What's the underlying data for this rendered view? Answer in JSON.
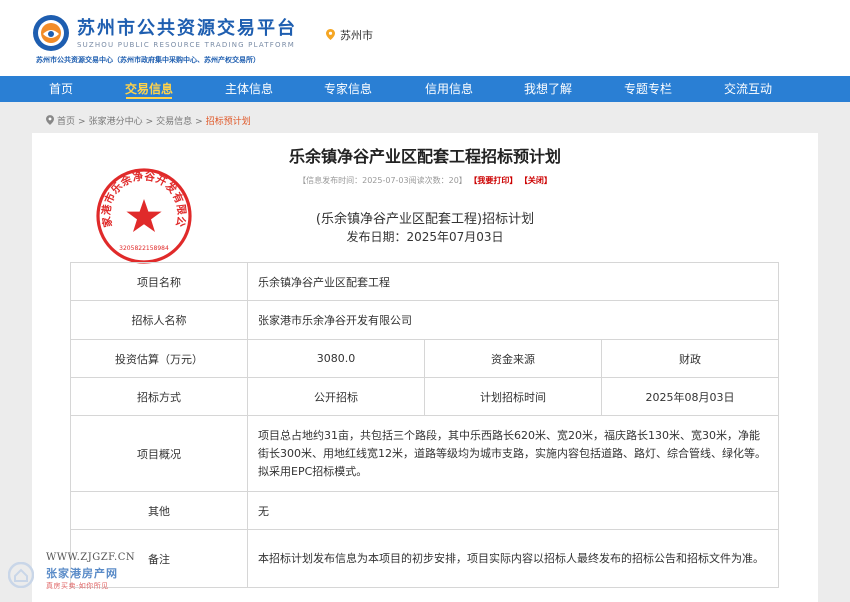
{
  "header": {
    "title": "苏州市公共资源交易平台",
    "title_en": "SUZHOU PUBLIC RESOURCE TRADING PLATFORM",
    "subtitle": "苏州市公共资源交易中心（苏州市政府集中采购中心、苏州产权交易所）",
    "location": "苏州市",
    "brand_color": "#1e5eb0"
  },
  "nav": {
    "color": "#2a7fd4",
    "active_color": "#ffd24a",
    "items": [
      {
        "label": "首页"
      },
      {
        "label": "交易信息"
      },
      {
        "label": "主体信息"
      },
      {
        "label": "专家信息"
      },
      {
        "label": "信用信息"
      },
      {
        "label": "我想了解"
      },
      {
        "label": "专题专栏"
      },
      {
        "label": "交流互动"
      }
    ]
  },
  "breadcrumb": {
    "items": [
      "首页",
      "张家港分中心",
      "交易信息"
    ],
    "separator": ">",
    "current": "招标预计划"
  },
  "article": {
    "title": "乐余镇净谷产业区配套工程招标预计划",
    "meta_text": "【信息发布时间：2025-07-03阅读次数：20】",
    "print_label": "【我要打印】",
    "close_label": "【关闭】",
    "plan_title": "(乐余镇净谷产业区配套工程)招标计划",
    "plan_date": "发布日期：2025年07月03日",
    "seal_text": "张家港市乐余净谷开发有限公司",
    "seal_number": "3205822158984"
  },
  "table": {
    "project_name_label": "项目名称",
    "project_name": "乐余镇净谷产业区配套工程",
    "tenderer_label": "招标人名称",
    "tenderer": "张家港市乐余净谷开发有限公司",
    "investment_label": "投资估算（万元）",
    "investment": "3080.0",
    "fund_source_label": "资金来源",
    "fund_source": "财政",
    "method_label": "招标方式",
    "method": "公开招标",
    "plan_time_label": "计划招标时间",
    "plan_time": "2025年08月03日",
    "overview_label": "项目概况",
    "overview": "项目总占地约31亩，共包括三个路段，其中乐西路长620米、宽20米，福庆路长130米、宽30米，净能街长300米、用地红线宽12米，道路等级均为城市支路，实施内容包括道路、路灯、综合管线、绿化等。拟采用EPC招标模式。",
    "other_label": "其他",
    "other": "无",
    "remark_label": "备注",
    "remark": "本招标计划发布信息为本项目的初步安排，项目实际内容以招标人最终发布的招标公告和招标文件为准。"
  },
  "watermark": {
    "url": "WWW.ZJGZF.CN",
    "name": "张家港房产网",
    "slogan": "真房买卖·如你所见"
  }
}
